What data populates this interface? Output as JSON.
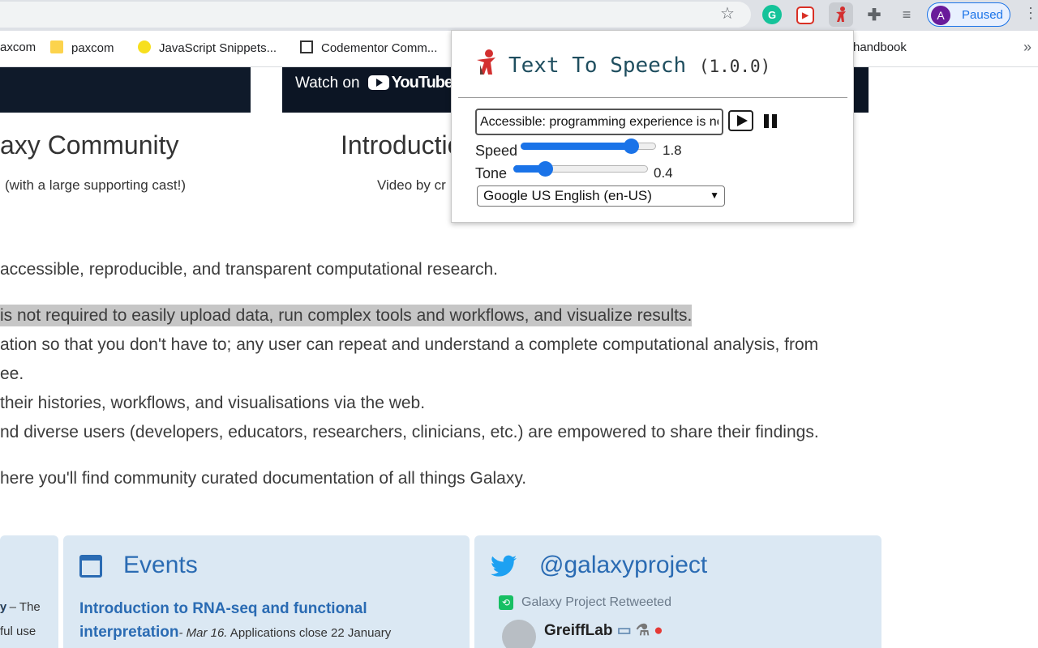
{
  "browser": {
    "profile_initial": "A",
    "profile_label": "Paused",
    "bookmarks": [
      {
        "label": "axcom"
      },
      {
        "label": "paxcom"
      },
      {
        "label": "JavaScript Snippets..."
      },
      {
        "label": "Codementor Comm..."
      },
      {
        "label": "handbook"
      }
    ]
  },
  "page": {
    "video_button": "Watch on",
    "video_brand": "YouTube",
    "left_heading": "axy Community",
    "left_sub": "(with a large supporting cast!)",
    "right_heading": "Introductio",
    "right_sub": "Video by cr",
    "paragraphs": [
      "accessible, reproducible, and transparent computational research.",
      "is not required to easily upload data, run complex tools and workflows, and visualize results.",
      "ation so that you don't have to; any user can repeat and understand a complete computational analysis, from",
      "ee.",
      "their histories, workflows, and visualisations via the web.",
      "nd diverse users (developers, educators, researchers, clinicians, etc.) are empowered to share their findings.",
      "here you'll find community curated documentation of all things Galaxy."
    ],
    "left_card_lines": [
      "y – The",
      "ful use"
    ],
    "events_title": "Events",
    "event_link": "Introduction to RNA-seq and functional interpretation",
    "event_date": "- Mar 16.",
    "event_note": " Applications close 22 January",
    "twitter_title": "@galaxyproject",
    "retweet_label": "Galaxy Project Retweeted",
    "tweet_user": "GreiffLab"
  },
  "popup": {
    "title": "Text To Speech",
    "version": "(1.0.0)",
    "text_input_value": "Accessible: programming experience is not required",
    "speed_label": "Speed",
    "speed_value": "1.8",
    "speed_level": 0.82,
    "tone_label": "Tone",
    "tone_value": "0.4",
    "tone_level": 0.23,
    "voice": "Google US English (en-US)"
  }
}
